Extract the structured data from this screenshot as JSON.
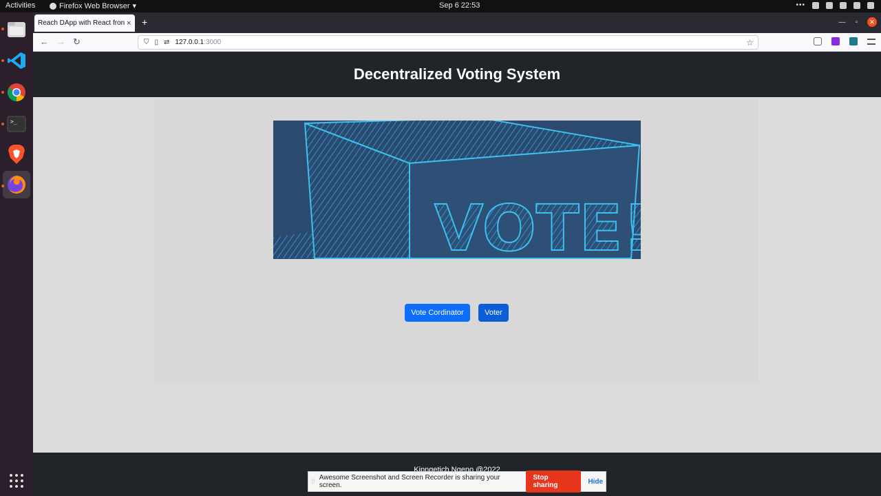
{
  "topbar": {
    "activities": "Activities",
    "app_name": "Firefox Web Browser",
    "clock": "Sep 6  22:53"
  },
  "dock": {
    "items": [
      "files",
      "vscode",
      "chrome",
      "terminal",
      "brave",
      "firefox"
    ],
    "apps_grid": "show-applications"
  },
  "browser": {
    "tab_title": "Reach DApp with React front",
    "new_tab": "+",
    "url_host": "127.0.0.1",
    "url_port": ":3000"
  },
  "page": {
    "title": "Decentralized Voting System",
    "hero_text": "VOTE!",
    "buttons": {
      "coordinator": "Vote Cordinator",
      "voter": "Voter"
    },
    "footer": "Kipngetich Ngeno @2022"
  },
  "sharebar": {
    "message": "Awesome Screenshot and Screen Recorder is sharing your screen.",
    "stop": "Stop sharing",
    "hide": "Hide"
  },
  "colors": {
    "header_bg": "#212529",
    "button_primary": "#0d6efd",
    "stop_sharing": "#e8361e",
    "hero_bg": "#2c4a70",
    "hero_stroke": "#2ba8e0"
  }
}
